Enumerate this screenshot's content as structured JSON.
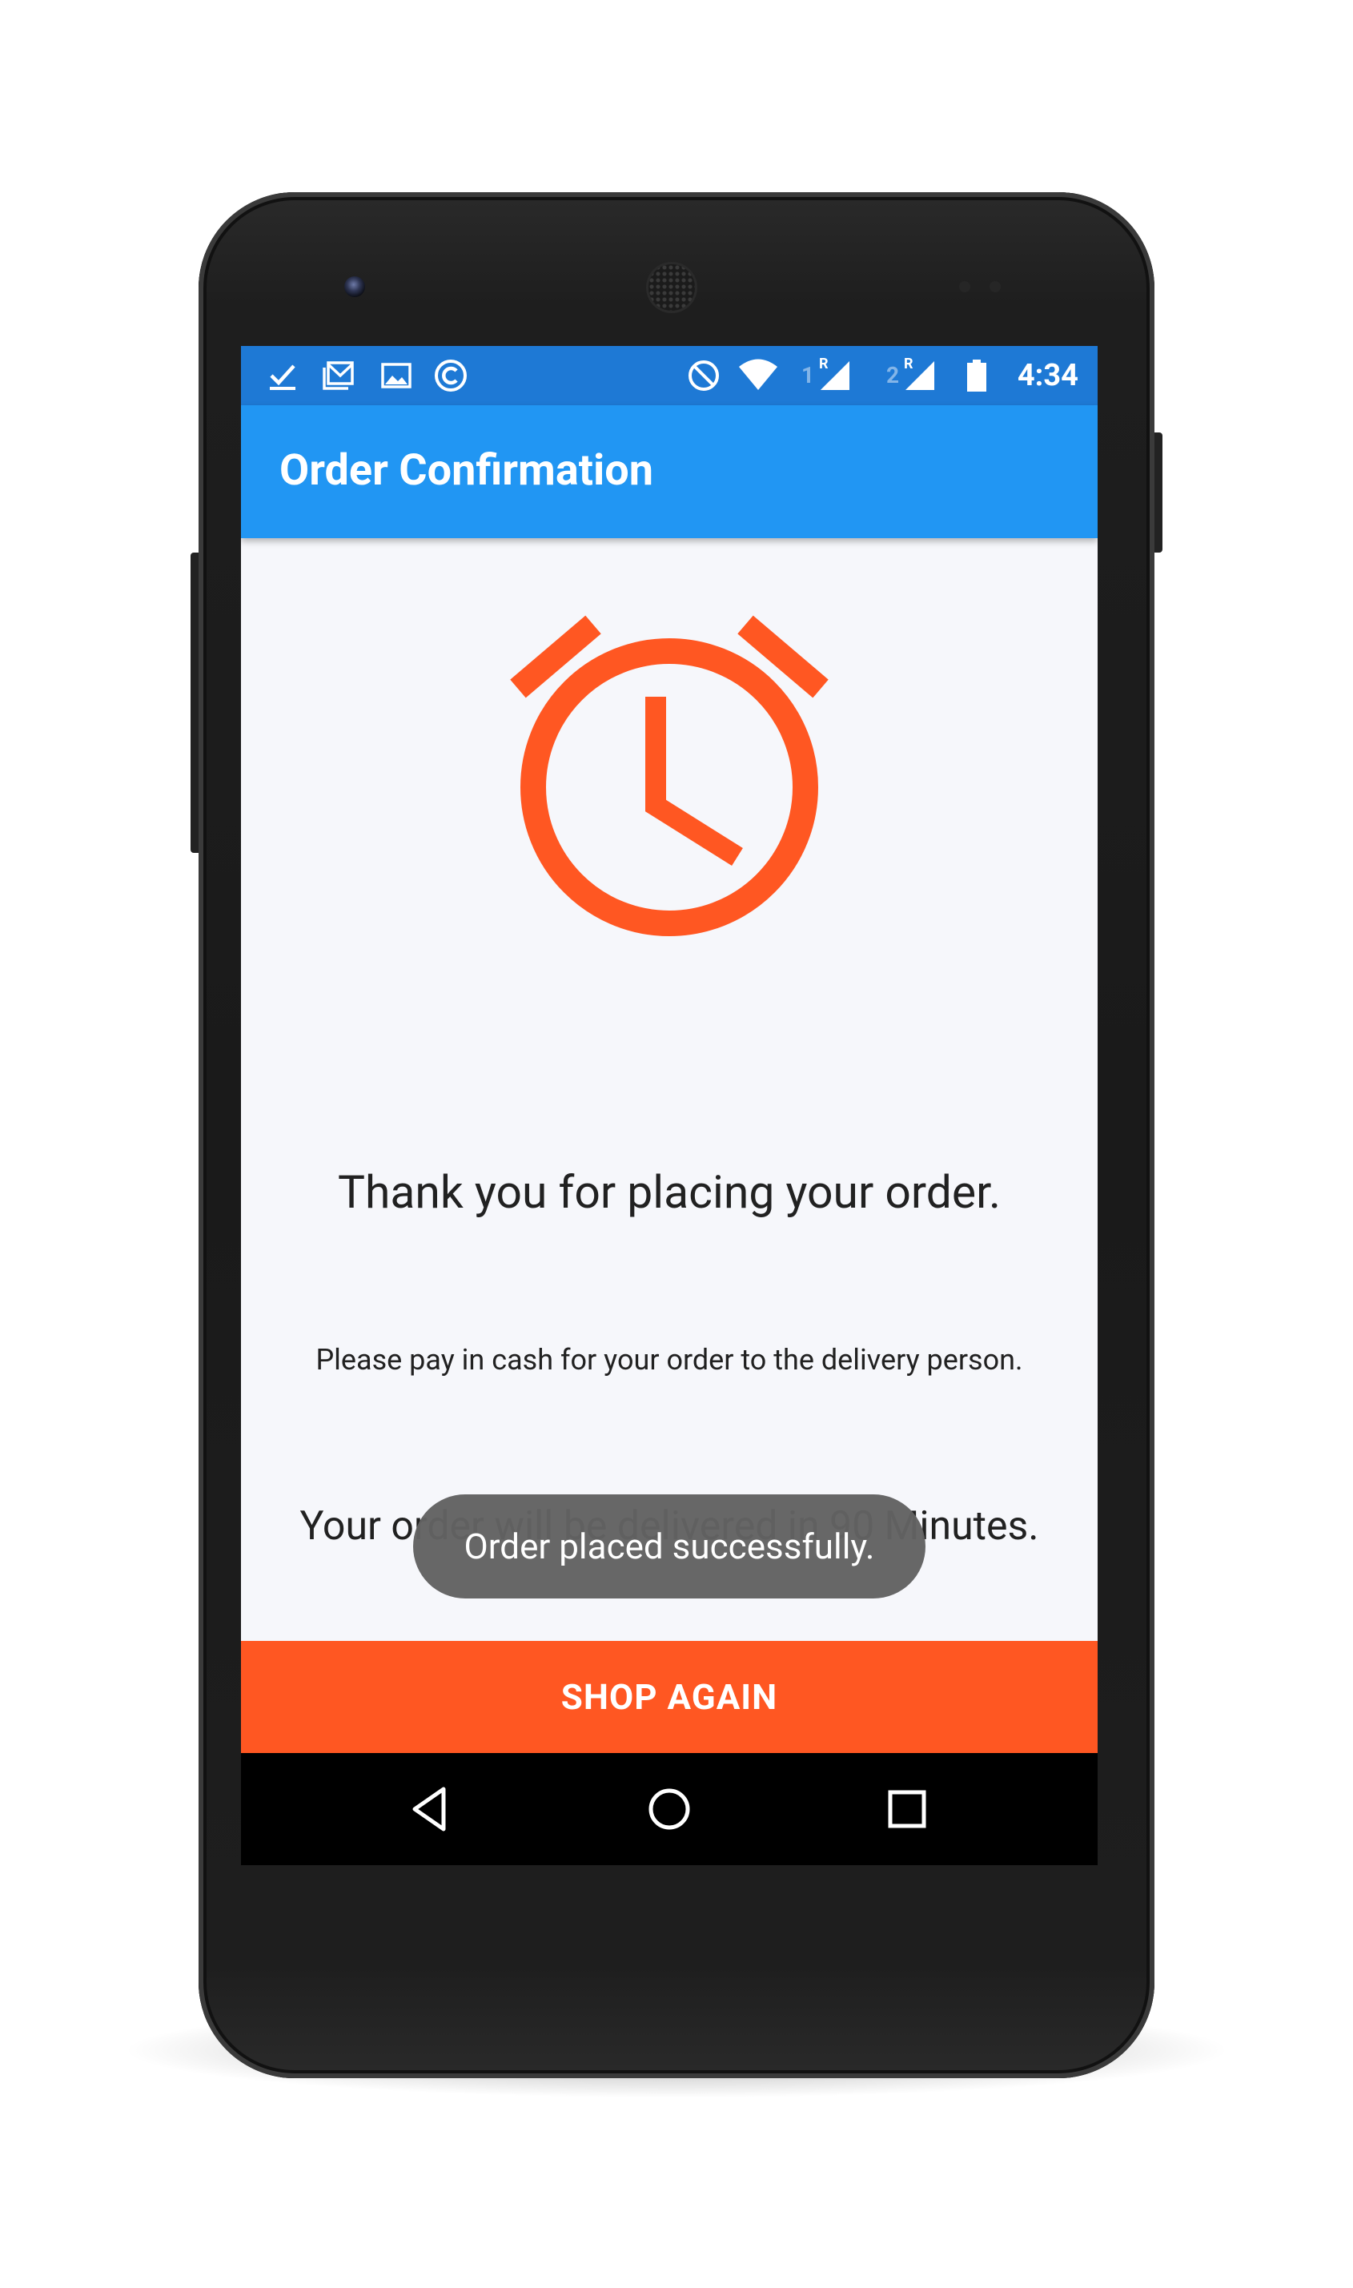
{
  "colors": {
    "status_bar": "#1e79d5",
    "app_bar": "#2196f3",
    "accent": "#ff5722",
    "screen_background": "#f6f7fb",
    "toast_background": "#626262",
    "nav_bar": "#000000"
  },
  "status_bar": {
    "time": "4:34",
    "notification_icons": [
      "checkmark-icon",
      "gmail-icon",
      "image-icon",
      "cast-c-icon"
    ],
    "system_icons": [
      "do-not-disturb-icon",
      "wifi-icon",
      "signal-sim1-roaming-icon",
      "signal-sim2-roaming-icon",
      "battery-icon"
    ],
    "sim1": {
      "number": "1",
      "roaming": "R"
    },
    "sim2": {
      "number": "2",
      "roaming": "R"
    }
  },
  "app_bar": {
    "title": "Order Confirmation"
  },
  "content": {
    "icon": "alarm-clock-icon",
    "thank_you": "Thank you for placing your order.",
    "payment_note": "Please pay in cash for your order to the delivery person.",
    "delivery_note": "Your order will be delivered in 90 Minutes."
  },
  "toast": {
    "message": "Order placed successfully."
  },
  "action_button": {
    "label": "SHOP AGAIN"
  },
  "navigation_bar": {
    "buttons": [
      "back-icon",
      "home-icon",
      "recents-icon"
    ]
  }
}
